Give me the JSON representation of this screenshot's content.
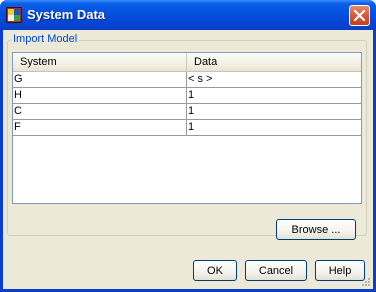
{
  "window": {
    "title": "System Data"
  },
  "group": {
    "label": "Import Model"
  },
  "table": {
    "columns": [
      "System",
      "Data"
    ],
    "rows": [
      {
        "system": "G",
        "data": "< s >"
      },
      {
        "system": "H",
        "data": "1"
      },
      {
        "system": "C",
        "data": "1"
      },
      {
        "system": "F",
        "data": "1"
      }
    ]
  },
  "buttons": {
    "browse": "Browse ...",
    "ok": "OK",
    "cancel": "Cancel",
    "help": "Help"
  },
  "icons": {
    "app": "app-icon",
    "close": "close-icon",
    "resize": "resize-grip-icon"
  },
  "colors": {
    "titlebar": "#0552e0",
    "client": "#ece9d8",
    "group_label": "#0046d5",
    "close_button": "#d9573a"
  }
}
